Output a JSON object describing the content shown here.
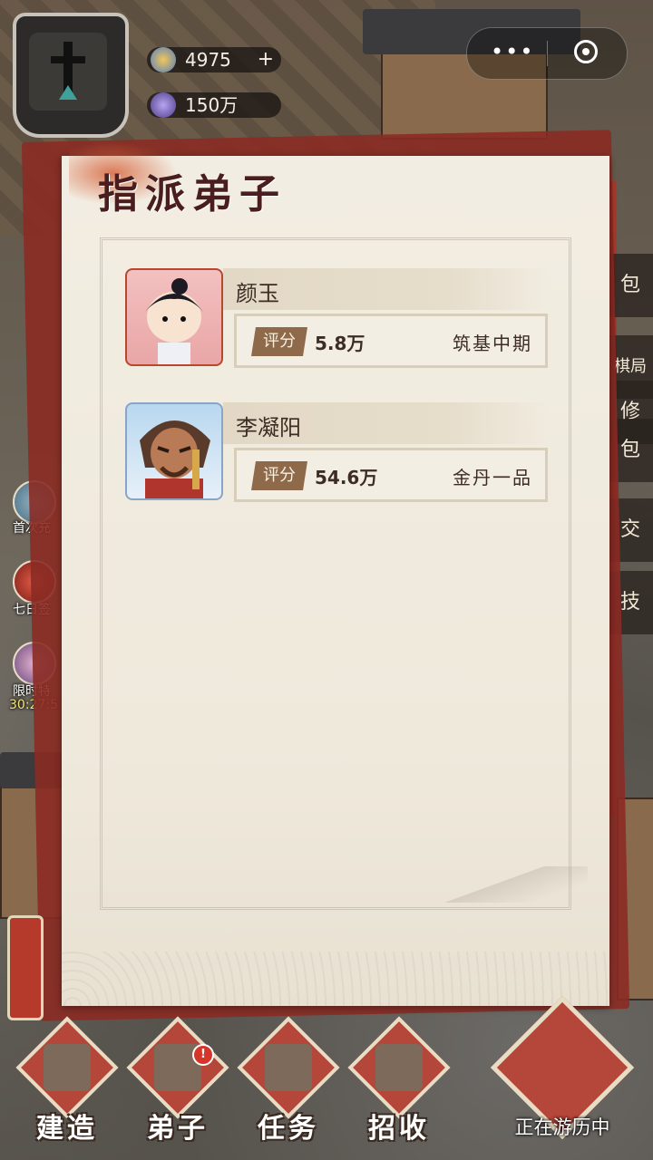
{
  "resources": {
    "coins": "4975",
    "coins_plus": "+",
    "spirit": "150万"
  },
  "menu_capsule": {
    "dots": "•••"
  },
  "side_menu": [
    {
      "label": "首次充"
    },
    {
      "label": "七日签"
    },
    {
      "label": "限时特"
    },
    {
      "label": "30:27:5"
    }
  ],
  "right_tabs": [
    {
      "label": "包"
    },
    {
      "label": "棋局"
    },
    {
      "label": "修"
    },
    {
      "label": "包"
    },
    {
      "label": "交"
    },
    {
      "label": "技"
    }
  ],
  "modal": {
    "title": "指派弟子",
    "disciples": [
      {
        "name": "颜玉",
        "score_label": "评分",
        "score": "5.8万",
        "realm": "筑基中期"
      },
      {
        "name": "李凝阳",
        "score_label": "评分",
        "score": "54.6万",
        "realm": "金丹一品"
      }
    ]
  },
  "bottom_nav": [
    {
      "label": "建造",
      "badge": false
    },
    {
      "label": "弟子",
      "badge": true
    },
    {
      "label": "任务",
      "badge": false
    },
    {
      "label": "招收",
      "badge": false
    }
  ],
  "travel": {
    "label": "正在游历中"
  },
  "colors": {
    "modal_bg": "#efe9dc",
    "accent_red": "#b5463a",
    "title_color": "#4a1e1e",
    "badge_brown": "#8e6a4a"
  }
}
